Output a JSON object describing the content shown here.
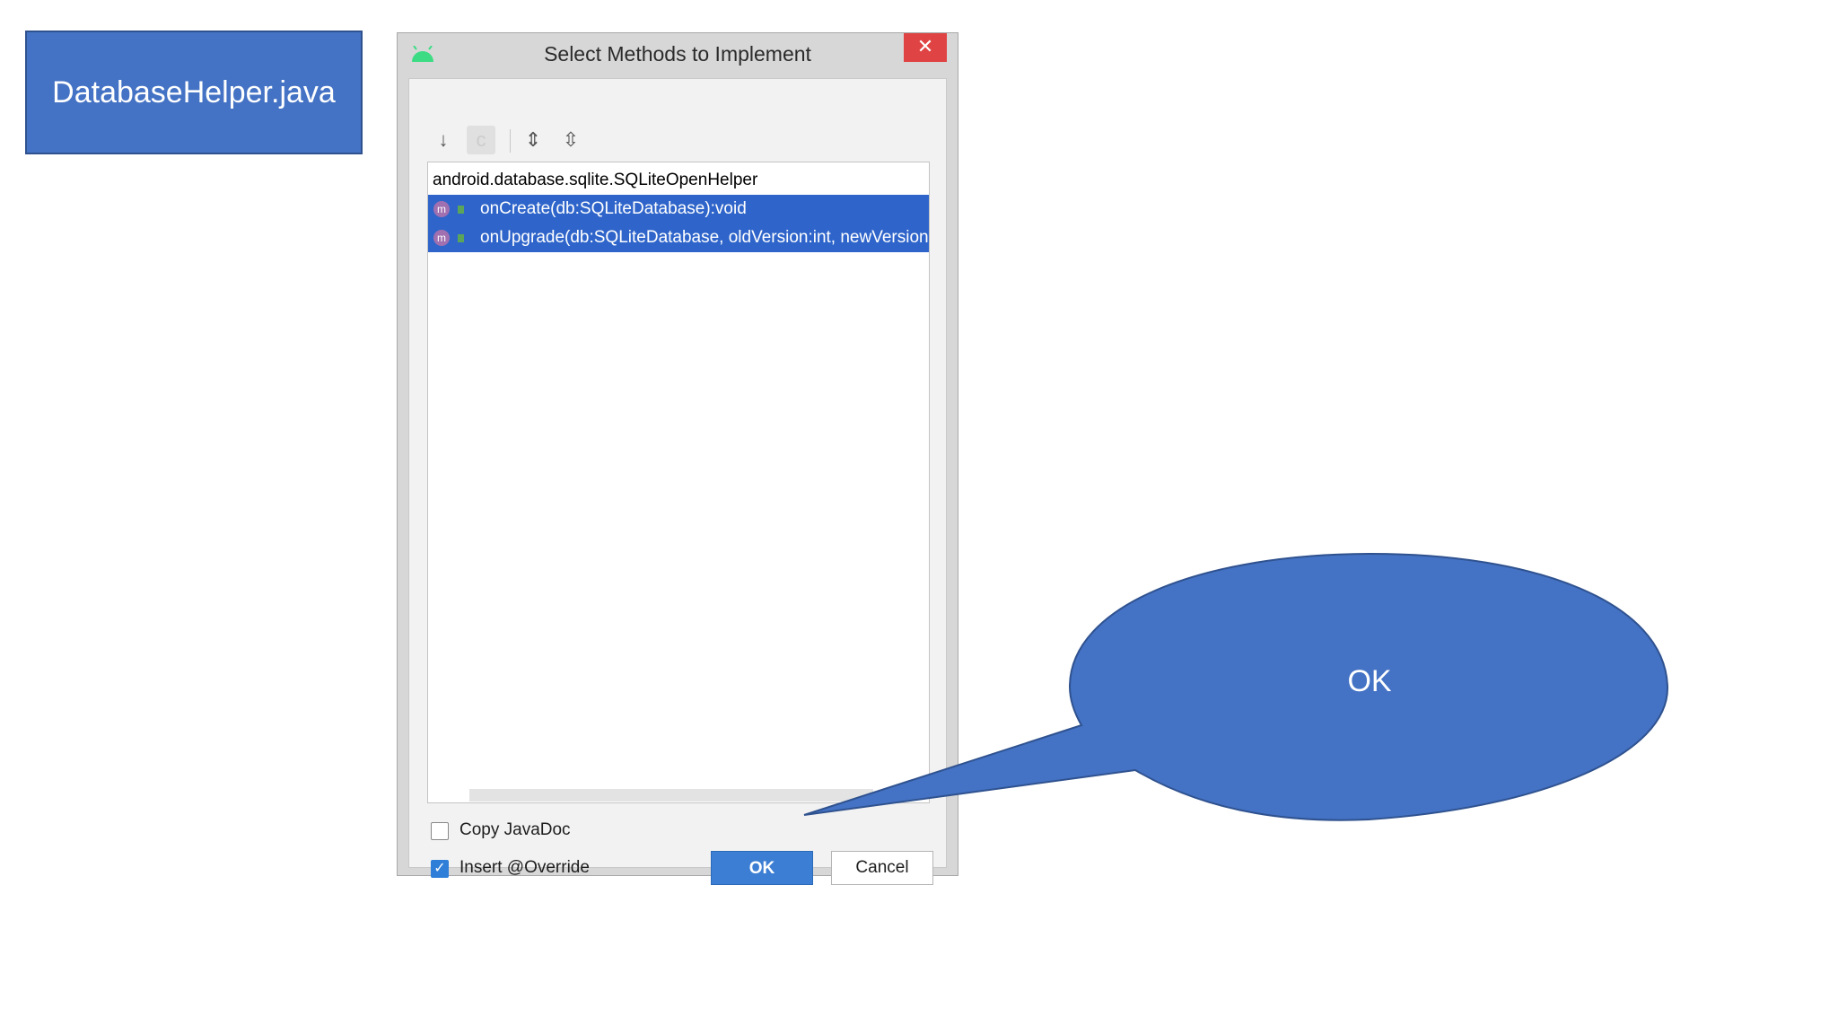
{
  "file_label": "DatabaseHelper.java",
  "dialog": {
    "title": "Select Methods to Implement",
    "close_glyph": "✕",
    "toolbar": [
      {
        "icon": "sort-alpha-icon",
        "glyph": "↓"
      },
      {
        "icon": "show-classes-icon",
        "glyph": "c"
      },
      {
        "icon": "expand-all-icon",
        "glyph": "⇕"
      },
      {
        "icon": "collapse-all-icon",
        "glyph": "⇳"
      }
    ],
    "tree": {
      "header": "android.database.sqlite.SQLiteOpenHelper",
      "items": [
        {
          "icon_glyph": "m",
          "label": "onCreate(db:SQLiteDatabase):void",
          "selected": true
        },
        {
          "icon_glyph": "m",
          "label": "onUpgrade(db:SQLiteDatabase, oldVersion:int, newVersion:",
          "selected": true
        }
      ]
    },
    "options": {
      "copy_javadoc": {
        "label": "Copy JavaDoc",
        "checked": false
      },
      "insert_override": {
        "label": "Insert @Override",
        "checked": true
      }
    },
    "buttons": {
      "ok": "OK",
      "cancel": "Cancel"
    }
  },
  "callout": {
    "text": "OK"
  },
  "colors": {
    "accent": "#4472c4",
    "selection": "#2f65ca",
    "close": "#e04343"
  }
}
